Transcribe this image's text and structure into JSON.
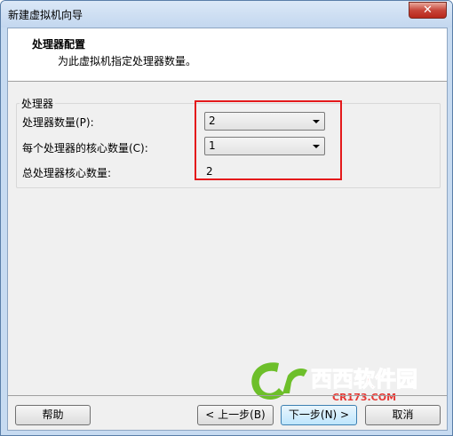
{
  "window": {
    "title": "新建虚拟机向导",
    "close_icon": "close-icon"
  },
  "header": {
    "title": "处理器配置",
    "subtitle": "为此虚拟机指定处理器数量。"
  },
  "processor": {
    "group_label": "处理器",
    "count_label": "处理器数量(P):",
    "count_value": "2",
    "cores_label": "每个处理器的核心数量(C):",
    "cores_value": "1",
    "total_label": "总处理器核心数量:",
    "total_value": "2"
  },
  "watermark": {
    "brand_cn": "西西软件园",
    "brand_url": "CR173.COM",
    "accent_color": "#6dbf2a",
    "brand_color": "#e53935"
  },
  "buttons": {
    "help": "帮助",
    "back": "< 上一步(B)",
    "next": "下一步(N) >",
    "cancel": "取消"
  }
}
